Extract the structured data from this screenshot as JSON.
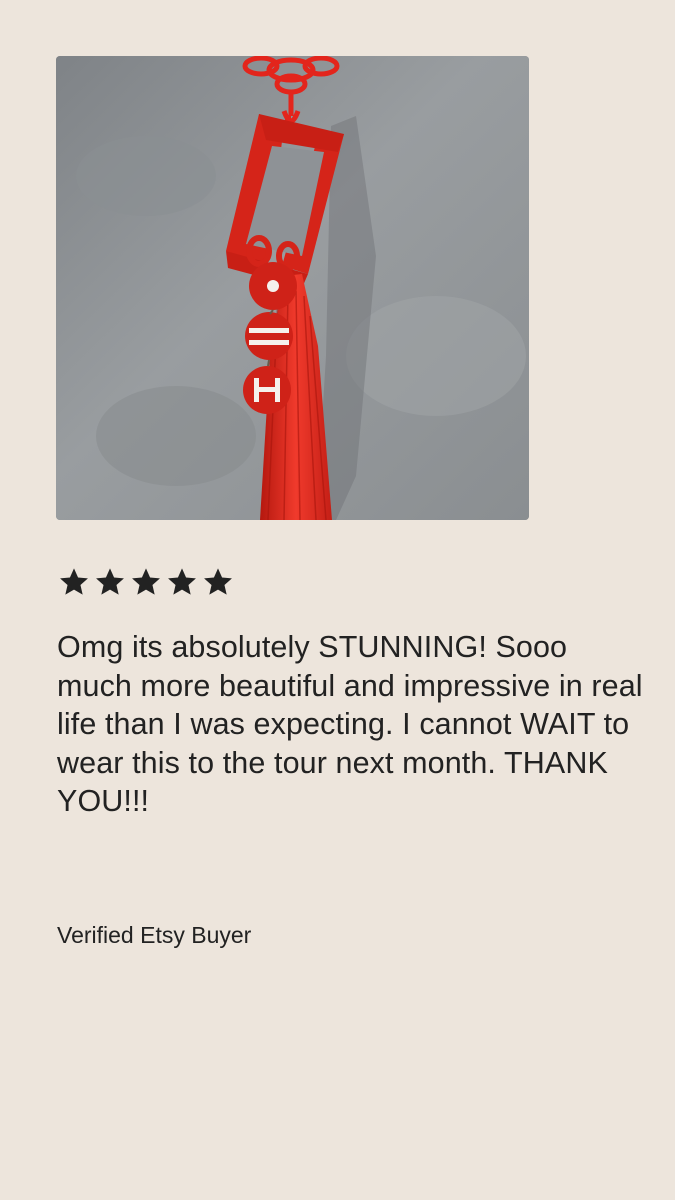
{
  "review": {
    "rating": 5,
    "rating_max": 5,
    "star_color": "#222222",
    "text": "Omg its absolutely STUNNING! Sooo much more beautiful and impressive in real life than I was expecting. I cannot WAIT to wear this to the tour next month. THANK YOU!!!",
    "reviewer": "Verified Etsy Buyer"
  },
  "photo": {
    "subject": "red-tassel-ornament-photo",
    "accent_color": "#d8261f"
  }
}
